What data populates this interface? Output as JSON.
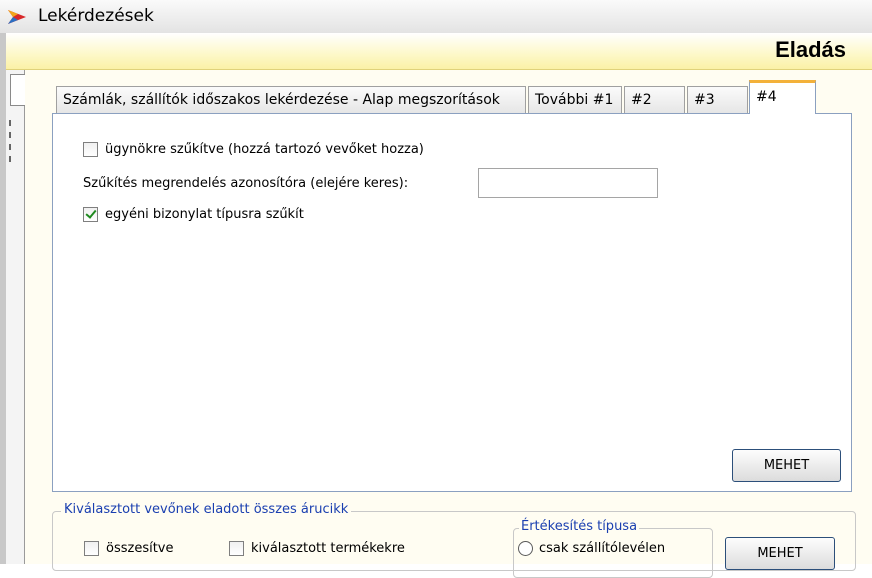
{
  "window": {
    "title": "Lekérdezések"
  },
  "header": {
    "title": "Eladás"
  },
  "tabs": [
    {
      "label": "Számlák, szállítók időszakos lekérdezése - Alap megszorítások"
    },
    {
      "label": "További #1"
    },
    {
      "label": "#2"
    },
    {
      "label": "#3"
    },
    {
      "label": "#4",
      "active": true
    }
  ],
  "panel": {
    "agent_checkbox": {
      "label": "ügynökre szűkítve (hozzá tartozó vevőket hozza)",
      "checked": false
    },
    "order_id_field": {
      "label": "Szűkítés megrendelés azonosítóra (elejére keres):",
      "value": ""
    },
    "doc_type_checkbox": {
      "label": "egyéni bizonylat típusra szűkít",
      "checked": true
    },
    "go_button": "MEHET"
  },
  "bottom_group": {
    "title": "Kiválasztott vevőnek eladott összes árucikk",
    "summary_checkbox": {
      "label": "összesítve",
      "checked": false
    },
    "selected_products_checkbox": {
      "label": "kiválasztott termékekre",
      "checked": false
    },
    "sales_type_group": {
      "title": "Értékesítés típusa",
      "options": [
        {
          "label": "csak szállítólevélen"
        }
      ]
    },
    "go_button": "MEHET"
  },
  "colors": {
    "accent_tab_top": "#f3b13a",
    "header_band": "#fbf1a6",
    "group_title": "#1a3fb0",
    "check": "#1f8a1f"
  }
}
